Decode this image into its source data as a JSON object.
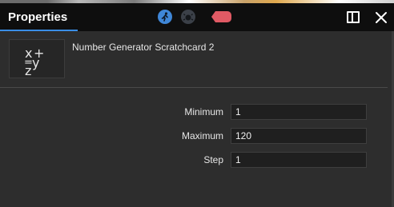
{
  "window": {
    "title": "Properties"
  },
  "toolbar": {
    "icons": [
      "run-icon",
      "debug-icon",
      "stop-icon"
    ],
    "colors": {
      "run": "#3f87d8",
      "debug": "#3b4048",
      "stop": "#e05a64"
    }
  },
  "node": {
    "icon": "formula-icon",
    "name": "Number Generator Scratchcard 2"
  },
  "fields": [
    {
      "label": "Minimum",
      "value": "1"
    },
    {
      "label": "Maximum",
      "value": "120"
    },
    {
      "label": "Step",
      "value": "1"
    }
  ],
  "accent": "#3a8ee6"
}
